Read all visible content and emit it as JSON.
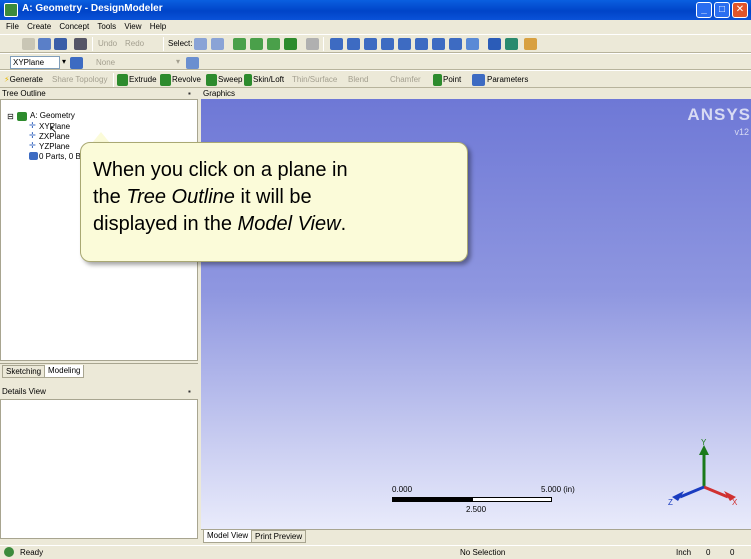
{
  "window": {
    "title": "A: Geometry - DesignModeler"
  },
  "menu": [
    "File",
    "Create",
    "Concept",
    "Tools",
    "View",
    "Help"
  ],
  "toolbar1": {
    "undo": "Undo",
    "redo": "Redo",
    "select_label": "Select:"
  },
  "toolbar2": {
    "plane_value": "XYPlane",
    "sketch_value": "None"
  },
  "toolbar3": {
    "generate": "Generate",
    "share_topology": "Share Topology",
    "extrude": "Extrude",
    "revolve": "Revolve",
    "sweep": "Sweep",
    "skinloft": "Skin/Loft",
    "thin_surface": "Thin/Surface",
    "blend": "Blend",
    "chamfer": "Chamfer",
    "point": "Point",
    "parameters": "Parameters"
  },
  "tree": {
    "header": "Tree Outline",
    "root": "A: Geometry",
    "items": [
      "XYPlane",
      "ZXPlane",
      "YZPlane",
      "0 Parts, 0 Bodies"
    ]
  },
  "tabs": {
    "sketching": "Sketching",
    "modeling": "Modeling"
  },
  "details": {
    "header": "Details View"
  },
  "graphics": {
    "header": "Graphics",
    "logo": "ANSYS",
    "version": "v12",
    "scale_left": "0.000",
    "scale_right": "5.000 (in)",
    "scale_mid": "2.500",
    "axis_y": "Y",
    "axis_x": "X",
    "axis_z": "Z"
  },
  "bottom_tabs": {
    "model_view": "Model View",
    "print_preview": "Print Preview"
  },
  "status": {
    "ready": "Ready",
    "selection": "No Selection",
    "units": "Inch",
    "val1": "0",
    "val2": "0"
  },
  "callout": {
    "line1": "When you click on a plane in",
    "line2_prefix": "the ",
    "line2_em": "Tree Outline",
    "line2_suffix": " it will be",
    "line3_prefix": "displayed in the ",
    "line3_em": "Model View",
    "line3_suffix": "."
  },
  "colors": {
    "titlebar": "#0a52d8",
    "graphics_top": "#6e78d6",
    "graphics_bottom": "#e9ebfb",
    "callout_bg": "#fbfbd9"
  }
}
